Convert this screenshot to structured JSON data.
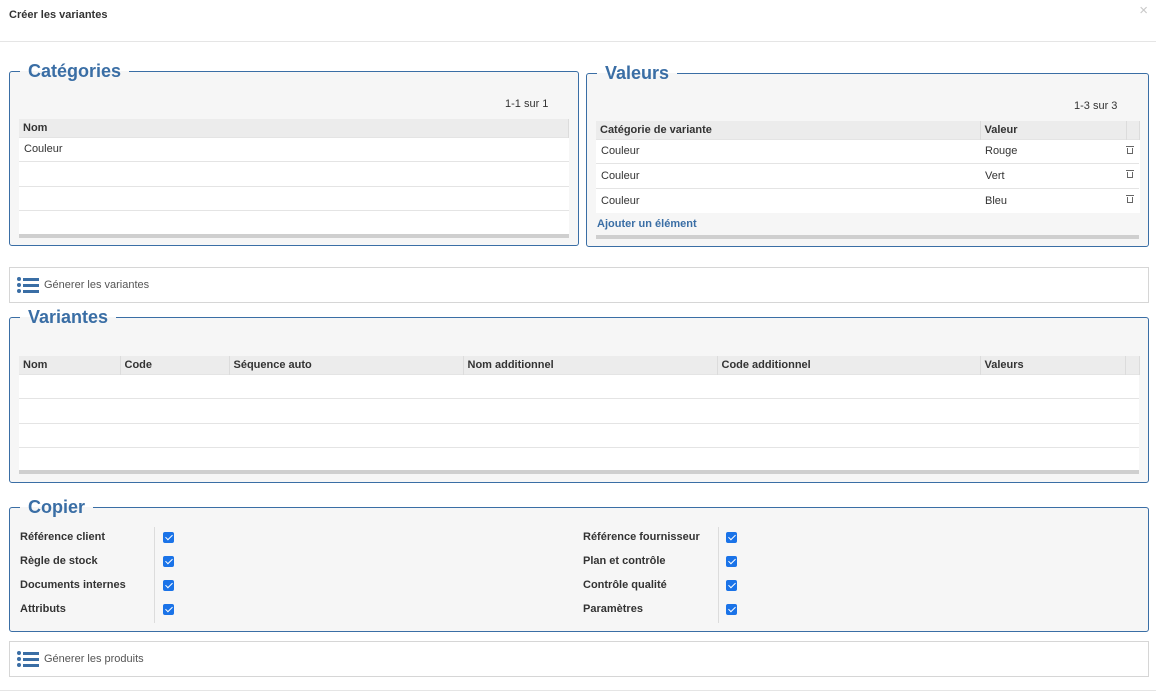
{
  "dialog": {
    "title": "Créer les variantes",
    "close": "×"
  },
  "categories": {
    "legend": "Catégories",
    "pager": "1-1 sur 1",
    "columns": [
      "Nom"
    ],
    "rows": [
      "Couleur",
      "",
      "",
      ""
    ]
  },
  "values": {
    "legend": "Valeurs",
    "pager": "1-3 sur 3",
    "columns": [
      "Catégorie de variante",
      "Valeur"
    ],
    "rows": [
      {
        "category": "Couleur",
        "value": "Rouge"
      },
      {
        "category": "Couleur",
        "value": "Vert"
      },
      {
        "category": "Couleur",
        "value": "Bleu"
      }
    ],
    "add_label": "Ajouter un élément"
  },
  "generate_variants": {
    "label": "Génerer les variantes",
    "icon": "list-icon"
  },
  "variants": {
    "legend": "Variantes",
    "columns": [
      "Nom",
      "Code",
      "Séquence auto",
      "Nom additionnel",
      "Code additionnel",
      "Valeurs"
    ]
  },
  "copy": {
    "legend": "Copier",
    "left": [
      {
        "label": "Référence client",
        "checked": true
      },
      {
        "label": "Règle de stock",
        "checked": true
      },
      {
        "label": "Documents internes",
        "checked": true
      },
      {
        "label": "Attributs",
        "checked": true
      }
    ],
    "right": [
      {
        "label": "Référence fournisseur",
        "checked": true
      },
      {
        "label": "Plan et contrôle",
        "checked": true
      },
      {
        "label": "Contrôle qualité",
        "checked": true
      },
      {
        "label": "Paramètres",
        "checked": true
      }
    ]
  },
  "generate_products": {
    "label": "Génerer les produits",
    "icon": "list-icon"
  },
  "colors": {
    "accent": "#3a6ea5",
    "checkbox": "#1a73e8",
    "panel_bg": "#f6f6f6"
  }
}
